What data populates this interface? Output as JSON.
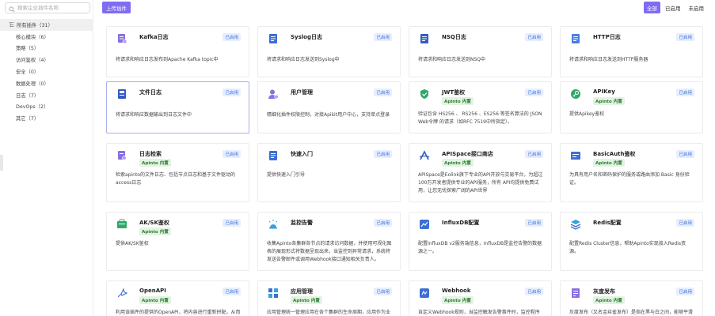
{
  "search": {
    "placeholder": "搜索企业插件名称"
  },
  "sidebar": {
    "items": [
      {
        "label": "所有插件（31）"
      },
      {
        "label": "核心模块（6）"
      },
      {
        "label": "策略（5）"
      },
      {
        "label": "访问鉴权（4）"
      },
      {
        "label": "安全（0）"
      },
      {
        "label": "数据处理（0）"
      },
      {
        "label": "日志（7）"
      },
      {
        "label": "DevOps（2）"
      },
      {
        "label": "其它（7）"
      }
    ]
  },
  "toolbar": {
    "upload_label": "上传插件"
  },
  "filter": {
    "all": "全部",
    "enabled": "已启用",
    "disabled": "未启用"
  },
  "colors": {
    "accent": "#7f6cf3",
    "status_text": "#3a6fd8",
    "builtin_text": "#2e7d32"
  },
  "cards": [
    {
      "name": "Kafka日志",
      "status": "已启用",
      "builtin": "",
      "icon": "kafka-log-icon",
      "desc": "将请求和响应日志发布到Apache Kafka topic中"
    },
    {
      "name": "Syslog日志",
      "status": "已启用",
      "builtin": "",
      "icon": "syslog-icon",
      "desc": "将请求和响应日志发送到Syslog中"
    },
    {
      "name": "NSQ日志",
      "status": "已启用",
      "builtin": "",
      "icon": "nsq-log-icon",
      "desc": "将请求和响应日志发送到NSQ中"
    },
    {
      "name": "HTTP日志",
      "status": "已启用",
      "builtin": "",
      "icon": "http-log-icon",
      "desc": "将请求和响应日志发送到HTTP服务器"
    },
    {
      "name": "文件日志",
      "status": "已启用",
      "builtin": "",
      "icon": "file-log-icon",
      "desc": "将请求和响应数据输出到日志文件中"
    },
    {
      "name": "用户管理",
      "status": "已启用",
      "builtin": "",
      "icon": "user-manage-icon",
      "desc": "精细化插件权限控制，对接Apikit用户中心，支持单点登录"
    },
    {
      "name": "JWT鉴权",
      "status": "已启用",
      "builtin": "Apinto 内置",
      "icon": "jwt-icon",
      "desc": "验证包含 HS256 、 RS256 、ES256 等签名算法的 JSON Web令牌 的请求（如RFC 7519中所指定）。"
    },
    {
      "name": "APIKey",
      "status": "已启用",
      "builtin": "Apinto 内置",
      "icon": "apikey-icon",
      "desc": "提供Apikey鉴权"
    },
    {
      "name": "日志检索",
      "status": "已启用",
      "builtin": "Apinto 内置",
      "icon": "log-search-icon",
      "desc": "检索apinto的文件日志、包括节点日志和基于文件驱动的access日志"
    },
    {
      "name": "快速入门",
      "status": "已启用",
      "builtin": "",
      "icon": "quick-start-icon",
      "desc": "提供快速入门引导"
    },
    {
      "name": "APISpace接口商店",
      "status": "已启用",
      "builtin": "Apinto 内置",
      "icon": "apispace-icon",
      "desc": "APISpace是Eolink旗下专业的API开放与交易平台，为超过100万开发者提供专业的API服务，所有 API均提供免费试用，让您无忧探索广阔的API世界"
    },
    {
      "name": "BasicAuth鉴权",
      "status": "已启用",
      "builtin": "Apinto 内置",
      "icon": "basic-auth-icon",
      "desc": "为具有用户名和密码保护的服务或路由添加 Basic 身份验证。"
    },
    {
      "name": "AK/SK鉴权",
      "status": "已启用",
      "builtin": "Apinto 内置",
      "icon": "aksk-icon",
      "desc": "提供AK/SK鉴权"
    },
    {
      "name": "监控告警",
      "status": "已启用",
      "builtin": "",
      "icon": "monitor-alert-icon",
      "desc": "收集Apinto各集群各节点的请求访问数据，并使用可视化图表的展现形式将数据呈现出来，当监控到异常请求，系统将发送告警邮件或调用Webhook接口通知相关负责人。"
    },
    {
      "name": "InfluxDB配置",
      "status": "已启用",
      "builtin": "",
      "icon": "influxdb-icon",
      "desc": "配置InfluxDB v2服务端信息，InfluxDB是监控告警的数据源之一。"
    },
    {
      "name": "Redis配置",
      "status": "已启用",
      "builtin": "",
      "icon": "redis-icon",
      "desc": "配置Redis Cluster信息，帮助Apinto实现接入Redis资源。"
    },
    {
      "name": "OpenAPI",
      "status": "已启用",
      "builtin": "Apinto 内置",
      "icon": "openapi-icon",
      "desc": "利用该插件的提供的OpenAPI，将内容进行重新拼配，从而"
    },
    {
      "name": "应用管理",
      "status": "已启用",
      "builtin": "Apinto 内置",
      "icon": "app-manage-icon",
      "desc": "应用管理统一管理应用在各个集群的生命周期，应用作为业"
    },
    {
      "name": "Webhook",
      "status": "已启用",
      "builtin": "Apinto 内置",
      "icon": "webhook-icon",
      "desc": "自定义Webhook规则，当监控触发告警事件时，监控程序将"
    },
    {
      "name": "灰度发布",
      "status": "已启用",
      "builtin": "Apinto 内置",
      "icon": "gray-release-icon",
      "desc": "灰度发布（又名金丝雀发布）是指在黑与白之间，能够平滑"
    }
  ]
}
